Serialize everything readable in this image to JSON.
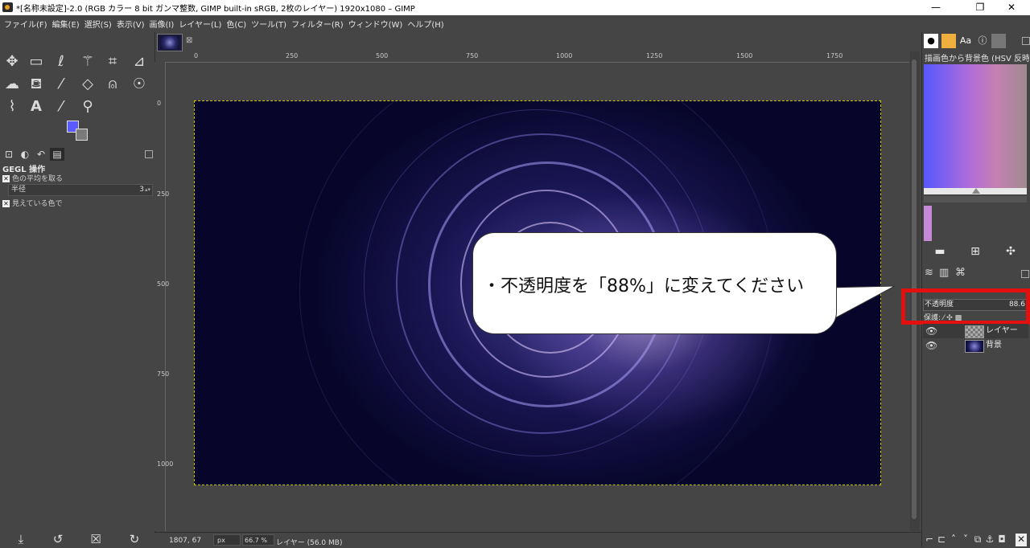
{
  "window": {
    "title": "*[名称未設定]-2.0 (RGB カラー 8 bit ガンマ整数, GIMP built-in sRGB, 2枚のレイヤー) 1920x1080 – GIMP"
  },
  "menu": [
    "ファイル(F)",
    "編集(E)",
    "選択(S)",
    "表示(V)",
    "画像(I)",
    "レイヤー(L)",
    "色(C)",
    "ツール(T)",
    "フィルター(R)",
    "ウィンドウ(W)",
    "ヘルプ(H)"
  ],
  "tool_options": {
    "title": "GEGL 操作",
    "option1": "色の平均を取る",
    "radius_label": "半径",
    "radius_value": "3",
    "option2": "見えている色で"
  },
  "ruler": {
    "h_labels": [
      "0",
      "250",
      "500",
      "750",
      "1000",
      "1250",
      "1500",
      "1750"
    ],
    "v_labels": [
      "0",
      "250",
      "500",
      "750",
      "1000"
    ]
  },
  "status": {
    "coords": "1807, 67",
    "unit": "px",
    "zoom": "66.7 %",
    "info": "レイヤー (56.0 MB)"
  },
  "callout": {
    "text": "・不透明度を「88%」に変えてください"
  },
  "gradient_panel": {
    "title": "描画色から背景色 (HSV 反時計"
  },
  "layers_panel": {
    "opacity_label": "不透明度",
    "opacity_value": "88.6",
    "lock_label": "保護: ⁄ ✣ ▩",
    "layers": [
      {
        "name": "レイヤー"
      },
      {
        "name": "背景"
      }
    ]
  },
  "colors": {
    "foreground": "#5a5aff",
    "background": "#7a7a7a",
    "highlight_box": "#e31010"
  }
}
